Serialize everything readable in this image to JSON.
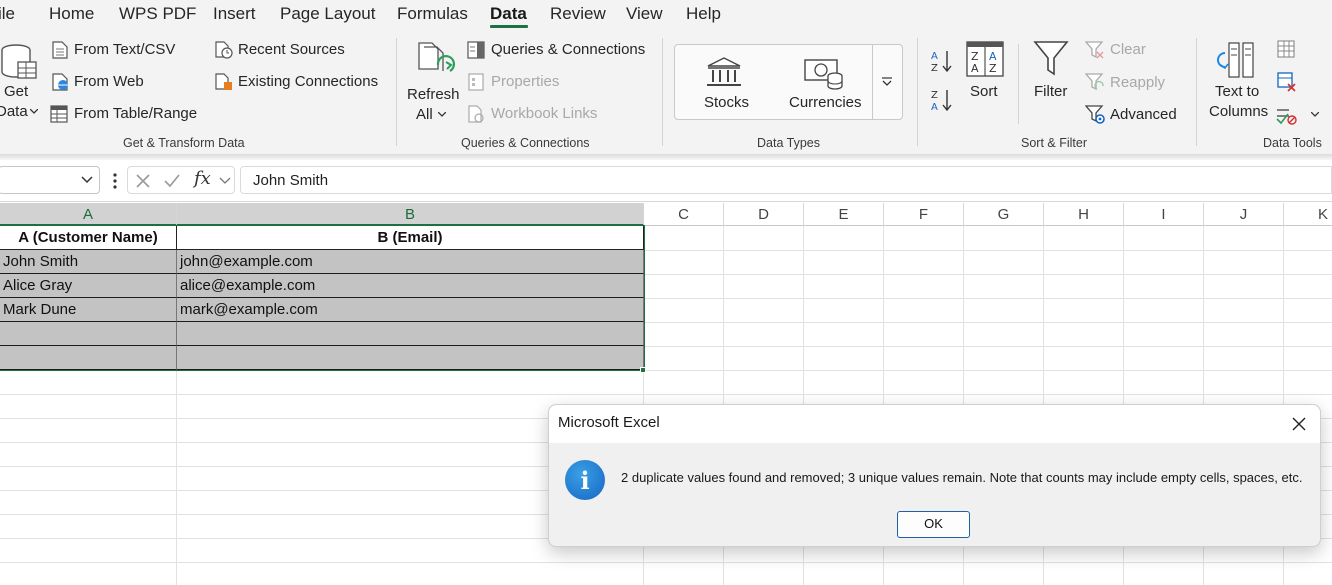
{
  "menu": {
    "tabs": [
      "ile",
      "Home",
      "WPS PDF",
      "Insert",
      "Page Layout",
      "Formulas",
      "Data",
      "Review",
      "View",
      "Help"
    ],
    "active_tab": "Data"
  },
  "ribbon": {
    "get_transform": {
      "get_data_line1": "Get",
      "get_data_line2": "Data",
      "from_text_csv": "From Text/CSV",
      "from_web": "From Web",
      "from_table_range": "From Table/Range",
      "recent_sources": "Recent Sources",
      "existing_connections": "Existing Connections",
      "group_label": "Get & Transform Data"
    },
    "queries": {
      "refresh_line1": "Refresh",
      "refresh_line2": "All",
      "queries_connections": "Queries & Connections",
      "properties": "Properties",
      "workbook_links": "Workbook Links",
      "group_label": "Queries & Connections"
    },
    "data_types": {
      "stocks": "Stocks",
      "currencies": "Currencies",
      "group_label": "Data Types"
    },
    "sort_filter": {
      "sort": "Sort",
      "filter": "Filter",
      "clear": "Clear",
      "reapply": "Reapply",
      "advanced": "Advanced",
      "group_label": "Sort & Filter"
    },
    "data_tools": {
      "text_to_columns_line1": "Text to",
      "text_to_columns_line2": "Columns",
      "group_label": "Data Tools"
    }
  },
  "formula_bar": {
    "name_box": "",
    "fx_label": "fx",
    "formula": "John Smith"
  },
  "grid": {
    "columns": [
      "A",
      "B",
      "C",
      "D",
      "E",
      "F",
      "G",
      "H",
      "I",
      "J",
      "K"
    ],
    "header_row": [
      "A (Customer Name)",
      "B (Email)"
    ],
    "rows": [
      [
        "John Smith",
        "john@example.com"
      ],
      [
        "Alice Gray",
        "alice@example.com"
      ],
      [
        "Mark Dune",
        "mark@example.com"
      ],
      [
        "",
        ""
      ],
      [
        "",
        ""
      ]
    ]
  },
  "dialog": {
    "title": "Microsoft Excel",
    "message": "2 duplicate values found and removed; 3 unique values remain. Note that counts may include empty cells, spaces, etc.",
    "ok_label": "OK"
  },
  "colors": {
    "accent_green": "#1e7145",
    "selection_fill": "#c3c3c3",
    "info_blue": "#1976d2",
    "ok_border": "#1f5fa8"
  }
}
